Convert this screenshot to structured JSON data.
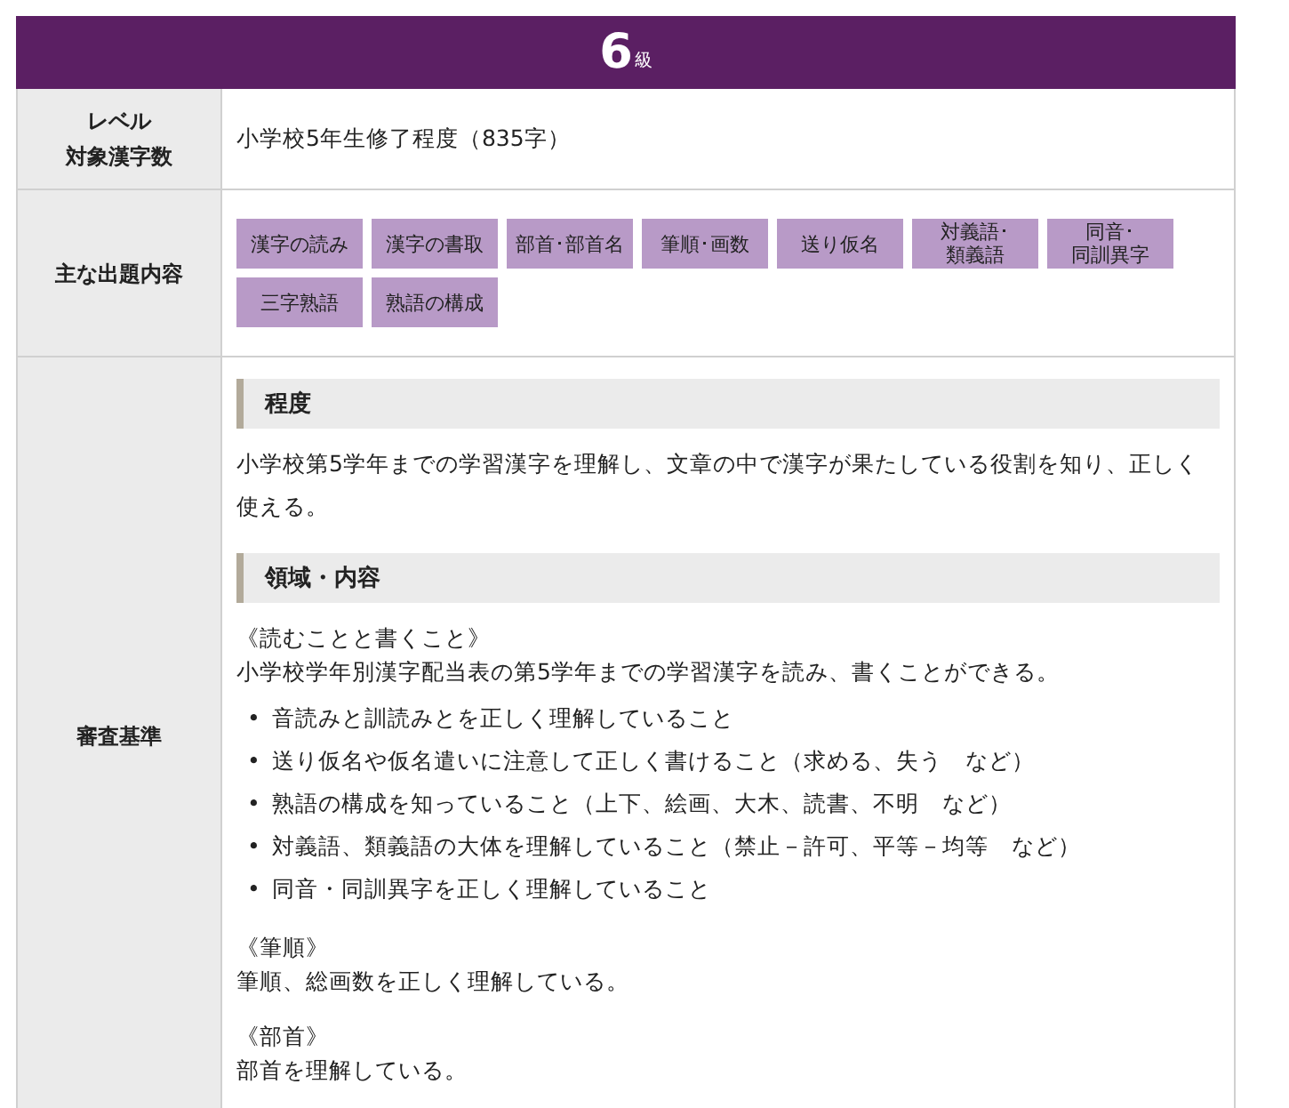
{
  "header": {
    "grade": "6",
    "unit": "級"
  },
  "level_row": {
    "label_lines": [
      "レベル",
      "対象漢字数"
    ],
    "value": "小学校5年生修了程度（835字）"
  },
  "topics_row": {
    "label": "主な出題内容",
    "tags": [
      "漢字の読み",
      "漢字の書取",
      "部首･部首名",
      "筆順･画数",
      "送り仮名",
      [
        "対義語･",
        "類義語"
      ],
      [
        "同音･",
        "同訓異字"
      ],
      "三字熟語",
      "熟語の構成"
    ]
  },
  "criteria_row": {
    "label": "審査基準",
    "blocks": [
      {
        "kind": "heading",
        "text": "程度"
      },
      {
        "kind": "paragraph",
        "text": "小学校第5学年までの学習漢字を理解し、文章の中で漢字が果たしている役割を知り、正しく使える。"
      },
      {
        "kind": "heading",
        "text": "領域・内容"
      },
      {
        "kind": "note",
        "text": "《読むことと書くこと》"
      },
      {
        "kind": "line",
        "text": "小学校学年別漢字配当表の第5学年までの学習漢字を読み、書くことができる。"
      },
      {
        "kind": "list",
        "marker": "•",
        "items": [
          "音読みと訓読みとを正しく理解していること",
          "送り仮名や仮名遣いに注意して正しく書けること（求める、失う　など）",
          "熟語の構成を知っていること（上下、絵画、大木、読書、不明　など）",
          "対義語、類義語の大体を理解していること（禁止－許可、平等－均等　など）",
          "同音・同訓異字を正しく理解していること"
        ]
      },
      {
        "kind": "note",
        "text": "《筆順》"
      },
      {
        "kind": "line",
        "text": "筆順、総画数を正しく理解している。"
      },
      {
        "kind": "note",
        "text": "《部首》"
      },
      {
        "kind": "line",
        "text": "部首を理解している。"
      }
    ]
  }
}
